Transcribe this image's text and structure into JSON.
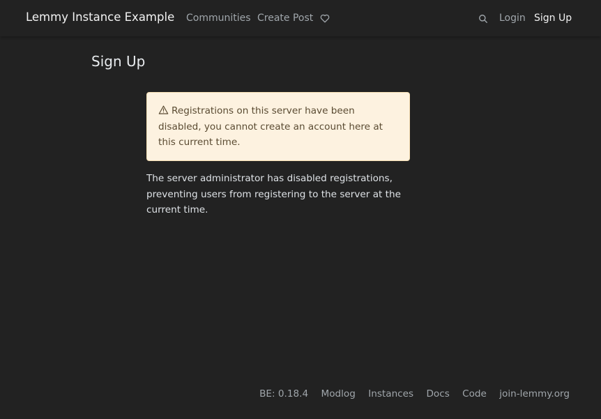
{
  "header": {
    "brand": "Lemmy Instance Example",
    "nav": {
      "communities": "Communities",
      "create_post": "Create Post",
      "login": "Login",
      "sign_up": "Sign Up"
    },
    "icons": {
      "donate": "heart-icon",
      "search": "search-icon"
    }
  },
  "main": {
    "title": "Sign Up",
    "alert": {
      "icon": "warning-triangle-icon",
      "text": "Registrations on this server have been disabled, you cannot create an account here at this current time."
    },
    "info": "The server administrator has disabled registrations, preventing users from registering to the server at the current time."
  },
  "footer": {
    "version": "BE: 0.18.4",
    "links": [
      "Modlog",
      "Instances",
      "Docs",
      "Code",
      "join-lemmy.org"
    ]
  },
  "colors": {
    "background": "#222222",
    "alert_background": "#fdf2e0",
    "alert_text": "#5a4b32",
    "muted_link": "#a0a6ab"
  }
}
